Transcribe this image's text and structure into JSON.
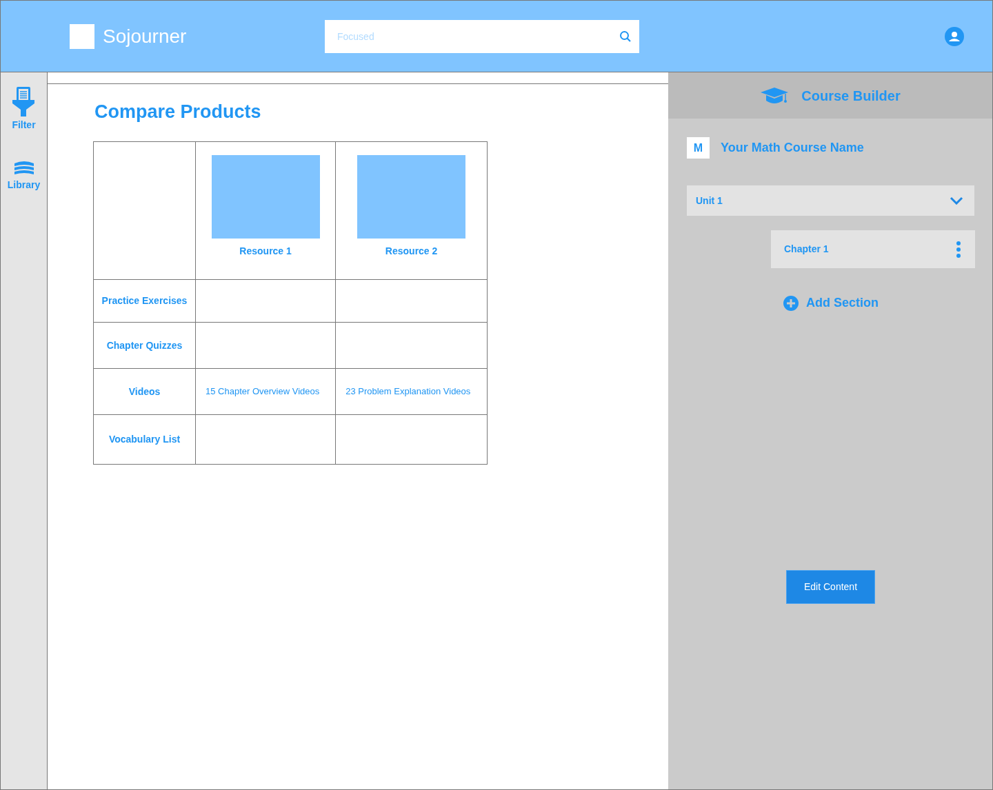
{
  "header": {
    "logo_text": "Sojourner",
    "search": {
      "placeholder": "Focused"
    }
  },
  "sidebar": {
    "items": [
      {
        "label": "Filter",
        "kind": "filter"
      },
      {
        "label": "Library",
        "kind": "library"
      }
    ]
  },
  "main": {
    "title": "Compare Products",
    "table": {
      "products": [
        {
          "name": "Resource 1"
        },
        {
          "name": "Resource 2"
        }
      ],
      "rows": [
        {
          "label": "Practice Exercises"
        },
        {
          "label": "Chapter Quizzes"
        },
        {
          "label": "Videos",
          "cells": [
            "15 Chapter Overview Videos",
            "23 Problem Explanation Videos"
          ]
        },
        {
          "label": "Vocabulary List"
        }
      ]
    }
  },
  "course_builder": {
    "title": "Course Builder",
    "course": {
      "initial": "M",
      "name": "Your Math Course Name"
    },
    "units": [
      {
        "label": "Unit 1",
        "expanded": true,
        "children": [
          {
            "label": "Chapter 1"
          }
        ]
      }
    ],
    "add_section": "Add Section",
    "edit_button": "Edit Content"
  }
}
